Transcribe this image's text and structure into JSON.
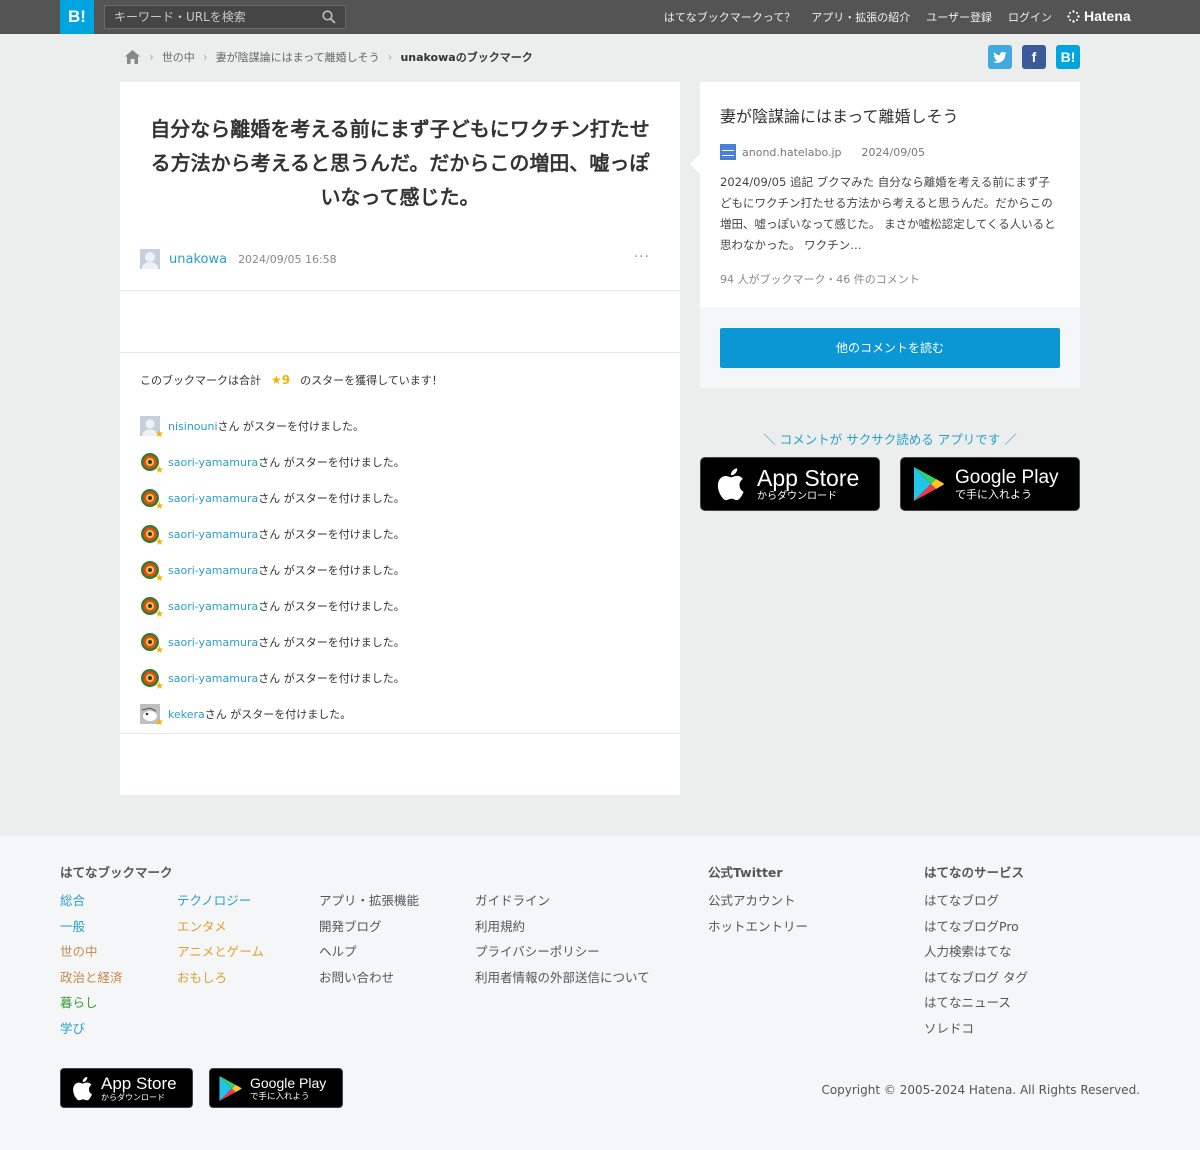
{
  "header": {
    "logo": "B!",
    "search_placeholder": "キーワード・URLを検索",
    "nav": [
      "はてなブックマークって？",
      "アプリ・拡張の紹介",
      "ユーザー登録",
      "ログイン"
    ],
    "brand": "Hatena"
  },
  "breadcrumb": {
    "items": [
      "世の中",
      "妻が陰謀論にはまって離婚しそう"
    ],
    "current": "unakowaのブックマーク"
  },
  "share": {
    "twitter": "twitter-icon",
    "facebook": "f",
    "hatena": "B!"
  },
  "comment": {
    "text": "自分なら離婚を考える前にまず子どもにワクチン打たせる方法から考えると思うんだ。だからこの増田、嘘っぽいなって感じた。",
    "author": "unakowa",
    "date": "2024/09/05 16:58",
    "more": "···"
  },
  "stars": {
    "prefix": "このブックマークは合計",
    "count": "★9",
    "suffix": "のスターを獲得しています！",
    "action": "さん がスターを付けました。",
    "users": [
      {
        "name": "nisinouni",
        "avatar": "default"
      },
      {
        "name": "saori-yamamura",
        "avatar": "ring"
      },
      {
        "name": "saori-yamamura",
        "avatar": "ring"
      },
      {
        "name": "saori-yamamura",
        "avatar": "ring"
      },
      {
        "name": "saori-yamamura",
        "avatar": "ring"
      },
      {
        "name": "saori-yamamura",
        "avatar": "ring"
      },
      {
        "name": "saori-yamamura",
        "avatar": "ring"
      },
      {
        "name": "saori-yamamura",
        "avatar": "ring"
      },
      {
        "name": "kekera",
        "avatar": "bird"
      }
    ]
  },
  "entry": {
    "title": "妻が陰謀論にはまって離婚しそう",
    "domain": "anond.hatelabo.jp",
    "date": "2024/09/05",
    "description": "2024/09/05 追記 ブクマみた 自分なら離婚を考える前にまず子どもにワクチン打たせる方法から考えると思うんだ。だからこの増田、嘘っぽいなって感じた。 まさか嘘松認定してくる人いると思わなかった。 ワクチン…",
    "counts": "94 人がブックマーク・46 件のコメント",
    "read_more": "他のコメントを読む"
  },
  "app_promo": "＼ コメントが サクサク読める アプリです ／",
  "stores": {
    "appstore_big": "App Store",
    "appstore_small": "からダウンロード",
    "googleplay_big": "Google Play",
    "googleplay_small": "で手に入れよう"
  },
  "footer": {
    "bookmark_heading": "はてなブックマーク",
    "categories_col1": [
      {
        "label": "総合",
        "color": "#2a9fc8"
      },
      {
        "label": "一般",
        "color": "#2a9fc8"
      },
      {
        "label": "世の中",
        "color": "#c58a4a"
      },
      {
        "label": "政治と経済",
        "color": "#c58a4a"
      },
      {
        "label": "暮らし",
        "color": "#3b9b3b"
      },
      {
        "label": "学び",
        "color": "#2a9fc8"
      }
    ],
    "categories_col2": [
      {
        "label": "テクノロジー",
        "color": "#2a9fc8"
      },
      {
        "label": "エンタメ",
        "color": "#e0a030"
      },
      {
        "label": "アニメとゲーム",
        "color": "#e0a030"
      },
      {
        "label": "おもしろ",
        "color": "#e0a030"
      }
    ],
    "links_col3": [
      "アプリ・拡張機能",
      "開発ブログ",
      "ヘルプ",
      "お問い合わせ"
    ],
    "links_col4": [
      "ガイドライン",
      "利用規約",
      "プライバシーポリシー",
      "利用者情報の外部送信について"
    ],
    "twitter_heading": "公式Twitter",
    "twitter_links": [
      "公式アカウント",
      "ホットエントリー"
    ],
    "services_heading": "はてなのサービス",
    "services": [
      "はてなブログ",
      "はてなブログPro",
      "人力検索はてな",
      "はてなブログ タグ",
      "はてなニュース",
      "ソレドコ"
    ],
    "copyright": "Copyright © 2005-2024 Hatena. All Rights Reserved."
  },
  "colors": {
    "accent": "#00a4de",
    "link": "#2a9fc8",
    "button": "#0b97d4",
    "star": "#f0b400"
  }
}
